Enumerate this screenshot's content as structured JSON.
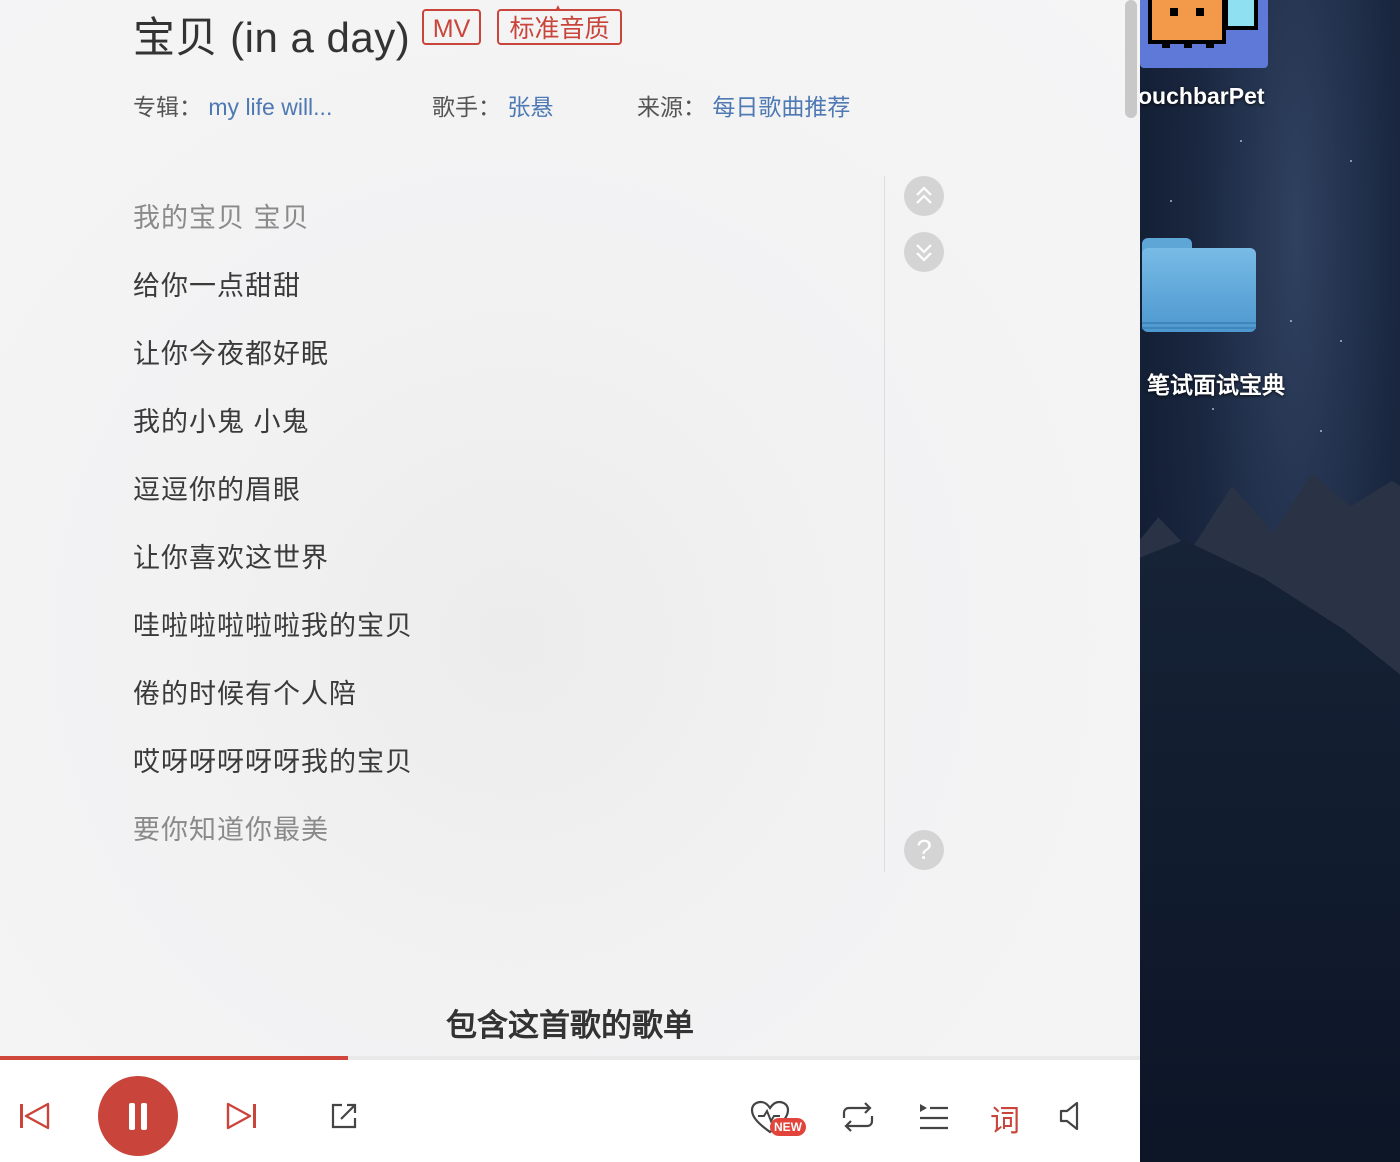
{
  "song": {
    "title": "宝贝 (in a day)",
    "mv_tag": "MV",
    "quality_tag": "标准音质"
  },
  "meta": {
    "album_label": "专辑：",
    "album_value": "my life will...",
    "singer_label": "歌手：",
    "singer_value": "张悬",
    "source_label": "来源：",
    "source_value": "每日歌曲推荐"
  },
  "lyrics": [
    {
      "text": "我的宝贝 宝贝",
      "dim": true
    },
    {
      "text": "给你一点甜甜",
      "dim": false
    },
    {
      "text": "让你今夜都好眠",
      "dim": false
    },
    {
      "text": "我的小鬼 小鬼",
      "dim": false
    },
    {
      "text": "逗逗你的眉眼",
      "dim": false
    },
    {
      "text": "让你喜欢这世界",
      "dim": false
    },
    {
      "text": "哇啦啦啦啦啦我的宝贝",
      "dim": false
    },
    {
      "text": "倦的时候有个人陪",
      "dim": false
    },
    {
      "text": "哎呀呀呀呀呀我的宝贝",
      "dim": false
    },
    {
      "text": "要你知道你最美",
      "dim": true
    }
  ],
  "lyric_controls": {
    "scroll_up_icon": "double-chevron-up-icon",
    "scroll_down_icon": "double-chevron-down-icon",
    "help_icon": "question-icon",
    "help_glyph": "?"
  },
  "playlist_heading": "包含这首歌的歌单",
  "player": {
    "progress_fraction": 0.305,
    "new_badge": "NEW",
    "lyrics_button": "词",
    "accent_color": "#c9453b"
  },
  "desktop": {
    "app_label": "ouchbarPet",
    "folder_label": "笔试面试宝典"
  }
}
